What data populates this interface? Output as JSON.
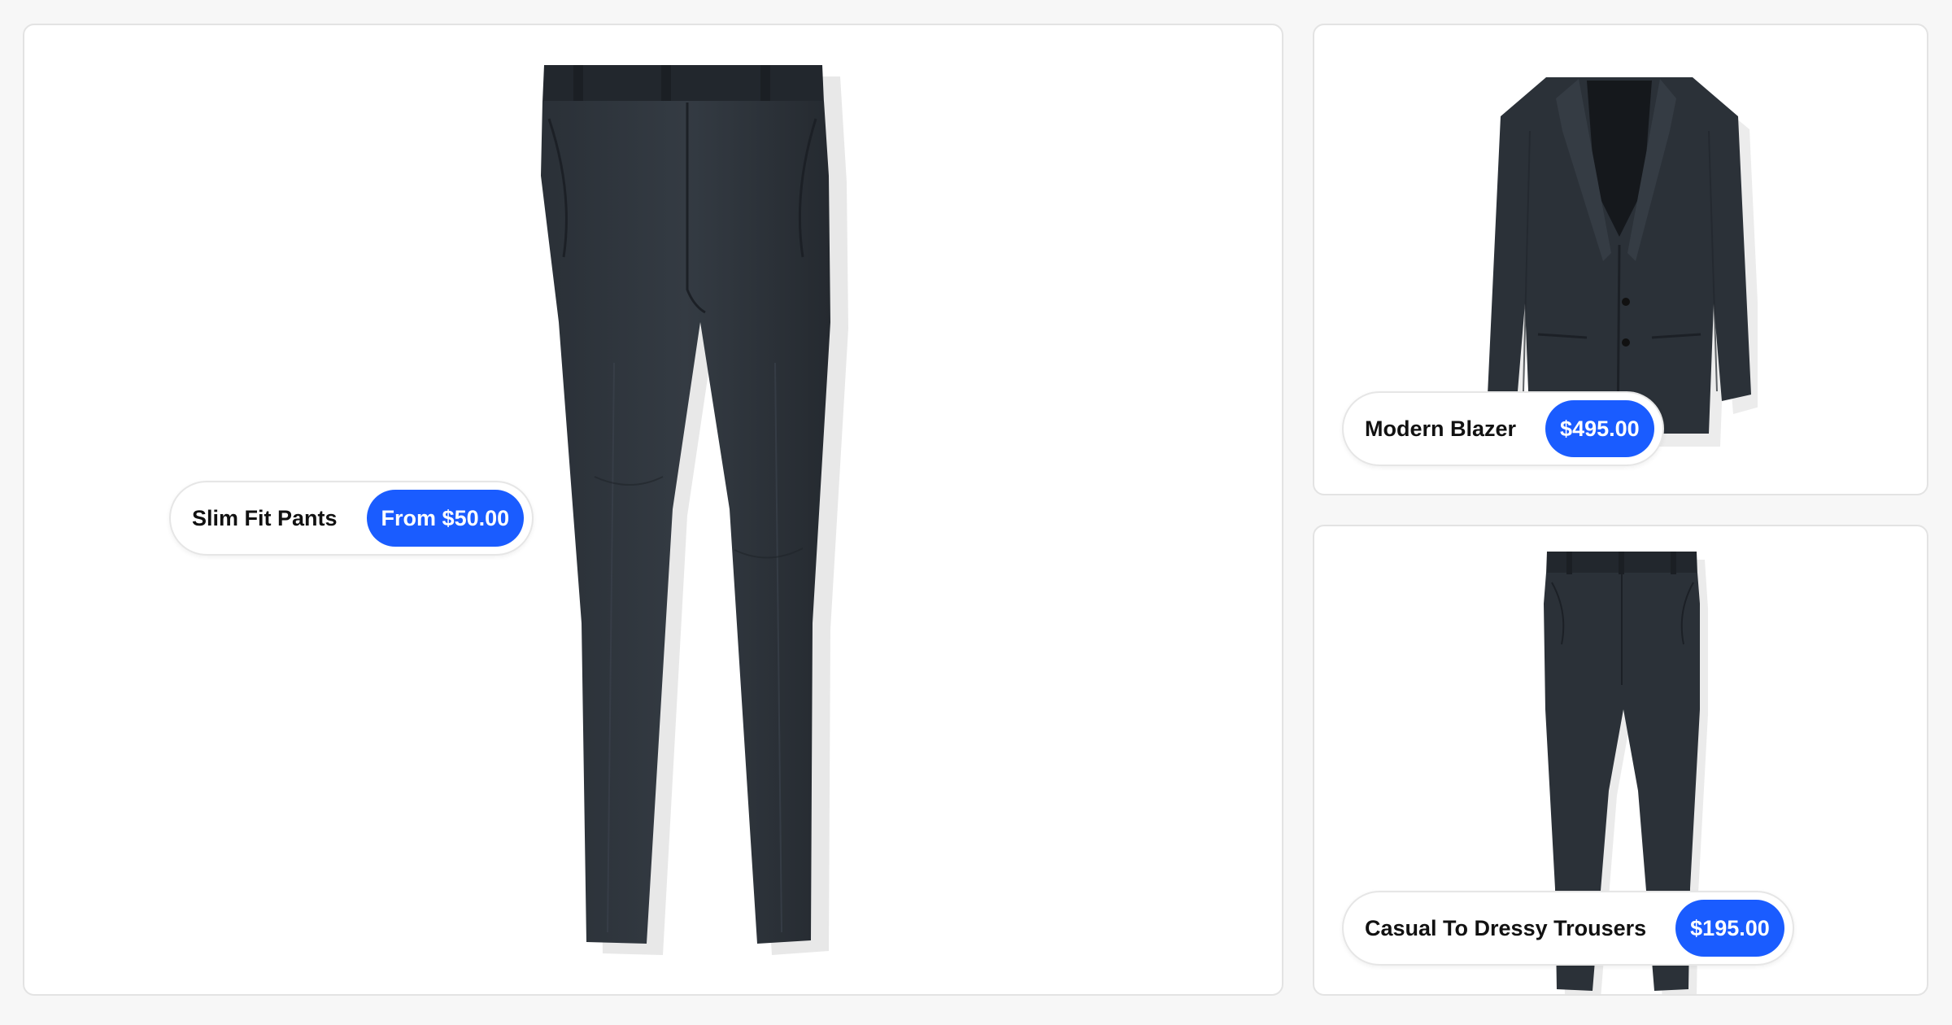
{
  "products": [
    {
      "name": "Slim Fit Pants",
      "price": "From $50.00",
      "image": "slim-fit-pants"
    },
    {
      "name": "Modern Blazer",
      "price": "$495.00",
      "image": "modern-blazer"
    },
    {
      "name": "Casual To Dressy Trousers",
      "price": "$195.00",
      "image": "casual-trousers"
    }
  ],
  "colors": {
    "accent": "#1a5cff",
    "garment": "#2b3138",
    "card_bg": "#ffffff",
    "page_bg": "#f7f7f7"
  }
}
